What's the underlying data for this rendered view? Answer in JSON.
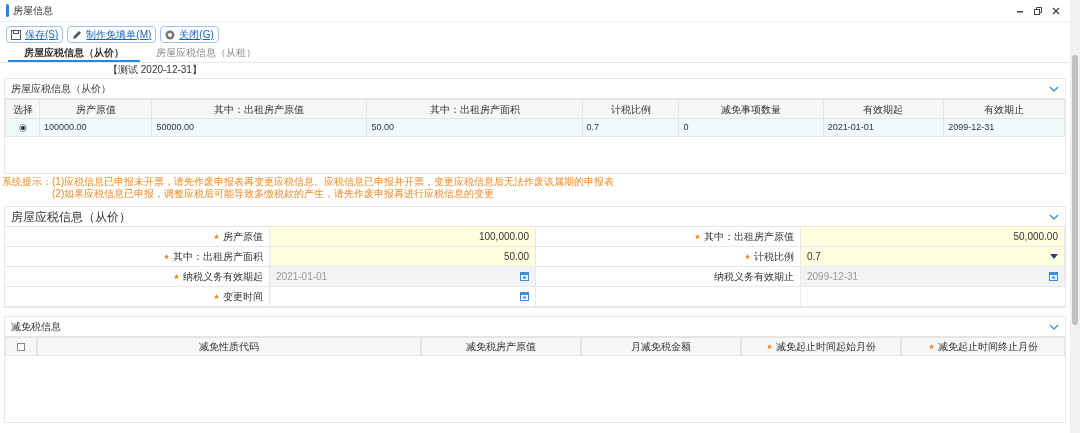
{
  "window": {
    "title": "房屋信息"
  },
  "toolbar": [
    {
      "label": "保存(S)",
      "kind": "save"
    },
    {
      "label": "制作免填单(M)",
      "kind": "edit"
    },
    {
      "label": "关闭(G)",
      "kind": "close"
    }
  ],
  "tabs": [
    {
      "label": "房屋应税信息（从价）",
      "selected": true
    },
    {
      "label": "房屋应税信息（从租）",
      "selected": false
    }
  ],
  "overlay_note": "【测试 2020-12-31】",
  "summary": {
    "title": "房屋应税信息（从价）",
    "select_column": "选择",
    "columns": [
      "房产原值",
      "其中：出租房产原值",
      "其中：出租房产面积",
      "计税比例",
      "减免事项数量",
      "有效期起",
      "有效期止"
    ],
    "rows": [
      {
        "selected": true,
        "cells": [
          "100000.00",
          "50000.00",
          "50.00",
          "0.7",
          "0",
          "2021-01-01",
          "2099-12-31"
        ]
      }
    ]
  },
  "notice": {
    "label": "系统提示：",
    "lines": [
      "(1)应税信息已申报未开票，请先作废申报表再变更应税信息。应税信息已申报并开票，变更应税信息后无法作废该属期的申报表",
      "(2)如果应税信息已申报，调整应税后可能导致多缴税款的产生，请先作废申报再进行应税信息的变更"
    ]
  },
  "form": {
    "title": "房屋应税信息（从价）",
    "fields": [
      {
        "label": "房产原值",
        "required": true,
        "kind": "number",
        "disabled": false,
        "value": "100,000.00"
      },
      {
        "label": "其中：出租房产原值",
        "required": true,
        "kind": "number",
        "disabled": false,
        "value": "50,000.00"
      },
      {
        "label": "其中：出租房产面积",
        "required": true,
        "kind": "number",
        "disabled": false,
        "value": "50.00"
      },
      {
        "label": "计税比例",
        "required": true,
        "kind": "select",
        "disabled": false,
        "value": "0.7"
      },
      {
        "label": "纳税义务有效期起",
        "required": true,
        "kind": "date",
        "disabled": true,
        "value": "2021-01-01"
      },
      {
        "label": "纳税义务有效期止",
        "required": false,
        "kind": "date",
        "disabled": true,
        "value": "2099-12-31"
      },
      {
        "label": "变更时间",
        "required": true,
        "kind": "date",
        "disabled": false
      }
    ]
  },
  "exemption": {
    "title": "减免税信息",
    "select_all": {
      "checked": false
    },
    "columns": [
      {
        "label": "减免性质代码",
        "required": false
      },
      {
        "label": "减免税房产原值",
        "required": false
      },
      {
        "label": "月减免税金额",
        "required": false
      },
      {
        "label": "减免起止时间起始月份",
        "required": true
      },
      {
        "label": "减免起止时间终止月份",
        "required": true
      }
    ]
  }
}
